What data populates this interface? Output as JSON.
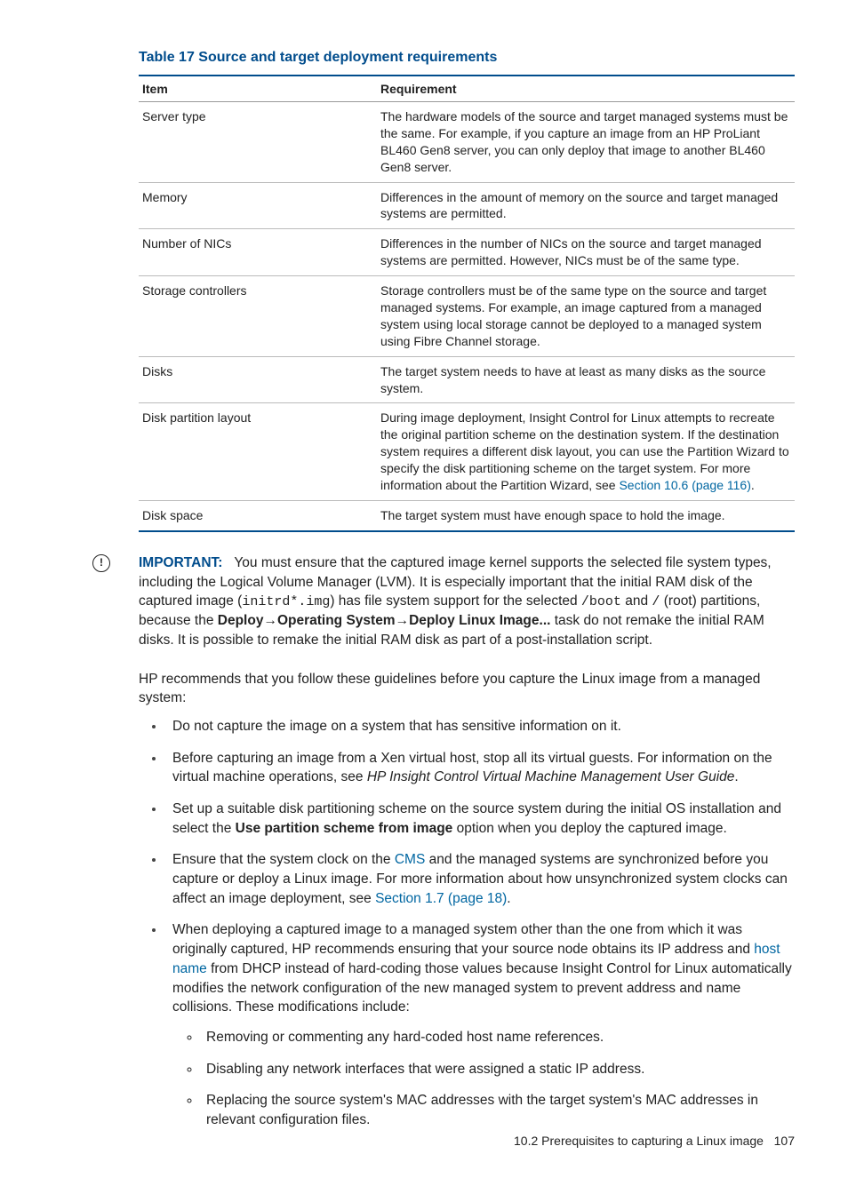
{
  "table": {
    "title": "Table 17 Source and target deployment requirements",
    "headers": {
      "item": "Item",
      "req": "Requirement"
    },
    "rows": [
      {
        "item": "Server type",
        "req": "The hardware models of the source and target managed systems must be the same. For example, if you capture an image from an HP ProLiant BL460 Gen8 server, you can only deploy that image to another BL460 Gen8 server."
      },
      {
        "item": "Memory",
        "req": "Differences in the amount of memory on the source and target managed systems are permitted."
      },
      {
        "item": "Number of NICs",
        "req": "Differences in the number of NICs on the source and target managed systems are permitted. However, NICs must be of the same type."
      },
      {
        "item": "Storage controllers",
        "req": "Storage controllers must be of the same type on the source and target managed systems. For example, an image captured from a managed system using local storage cannot be deployed to a managed system using Fibre Channel storage."
      },
      {
        "item": "Disks",
        "req": "The target system needs to have at least as many disks as the source system."
      },
      {
        "item": "Disk partition layout",
        "req_pre": "During image deployment, Insight Control for Linux attempts to recreate the original partition scheme on the destination system. If the destination system requires a different disk layout, you can use the Partition Wizard to specify the disk partitioning scheme on the target system. For more information about the Partition Wizard, see ",
        "req_link": "Section 10.6 (page 116)",
        "req_post": "."
      },
      {
        "item": "Disk space",
        "req": "The target system must have enough space to hold the image."
      }
    ]
  },
  "important": {
    "label": "IMPORTANT:",
    "pre": "You must ensure that the captured image kernel supports the selected file system types, including the Logical Volume Manager (LVM). It is especially important that the initial RAM disk of the captured image (",
    "code1": "initrd*.img",
    "mid1": ") has file system support for the selected ",
    "code2": "/boot",
    "mid2": " and ",
    "code3": "/",
    "mid3": " (root) partitions, because the ",
    "bold_path": "Deploy→Operating System→Deploy Linux Image...",
    "post": " task do not remake the initial RAM disks. It is possible to remake the initial RAM disk as part of a post-installation script."
  },
  "para1": "HP recommends that you follow these guidelines before you capture the Linux image from a managed system:",
  "bullets": {
    "b1": "Do not capture the image on a system that has sensitive information on it.",
    "b2_pre": "Before capturing an image from a Xen virtual host, stop all its virtual guests. For information on the virtual machine operations, see ",
    "b2_italic": "HP Insight Control Virtual Machine Management User Guide",
    "b2_post": ".",
    "b3_pre": "Set up a suitable disk partitioning scheme on the source system during the initial OS installation and select the ",
    "b3_bold": "Use partition scheme from image",
    "b3_post": " option when you deploy the captured image.",
    "b4_pre": "Ensure that the system clock on the ",
    "b4_link1": "CMS",
    "b4_mid": " and the managed systems are synchronized before you capture or deploy a Linux image. For more information about how unsynchronized system clocks can affect an image deployment, see ",
    "b4_link2": "Section 1.7 (page 18)",
    "b4_post": ".",
    "b5_pre": "When deploying a captured image to a managed system other than the one from which it was originally captured, HP recommends ensuring that your source node obtains its IP address and ",
    "b5_link": "host name",
    "b5_post": " from DHCP instead of hard-coding those values because Insight Control for Linux automatically modifies the network configuration of the new managed system to prevent address and name collisions. These modifications include:",
    "sub1": "Removing or commenting any hard-coded host name references.",
    "sub2": "Disabling any network interfaces that were assigned a static IP address.",
    "sub3": "Replacing the source system's MAC addresses with the target system's MAC addresses in relevant configuration files."
  },
  "footer": {
    "section": "10.2 Prerequisites to capturing a Linux image",
    "page": "107"
  }
}
